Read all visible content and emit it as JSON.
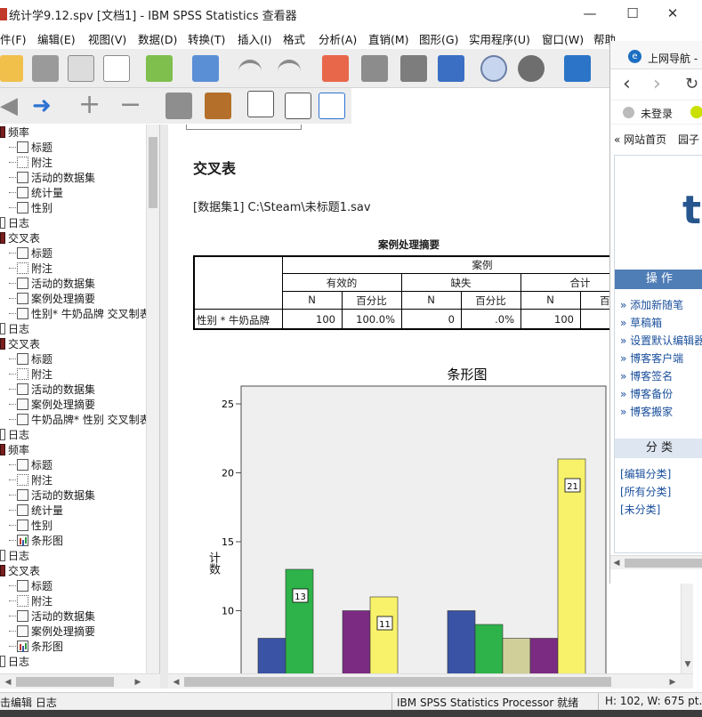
{
  "window": {
    "title": "统计学9.12.spv [文档1] - IBM SPSS Statistics 查看器",
    "minimize": "—",
    "maximize": "☐",
    "close": "✕"
  },
  "menu": [
    "件(F)",
    "编辑(E)",
    "视图(V)",
    "数据(D)",
    "转换(T)",
    "插入(I)",
    "格式",
    "分析(A)",
    "直销(M)",
    "图形(G)",
    "实用程序(U)",
    "窗口(W)",
    "帮助"
  ],
  "toolbar1": [
    "open-folder-icon",
    "save-icon",
    "print-icon",
    "print-preview-icon",
    "export-icon",
    "recall-dialog-icon",
    "undo-icon",
    "redo-icon",
    "goto-data-icon",
    "goto-case-icon",
    "goto-variable-icon",
    "variables-icon",
    "use-sets-icon",
    "show-all-icon",
    "spelling-icon"
  ],
  "toolbar2": [
    "back-arrow-icon",
    "forward-arrow-icon",
    "expand-plus-icon",
    "collapse-minus-icon",
    "show-icon",
    "hide-icon",
    "insert-heading-icon",
    "insert-title-icon",
    "insert-text-icon"
  ],
  "outline": [
    {
      "level": 0,
      "label": "频率",
      "icon": "book"
    },
    {
      "level": 1,
      "label": "标题",
      "icon": "doc"
    },
    {
      "level": 1,
      "label": "附注",
      "icon": "hidden"
    },
    {
      "level": 1,
      "label": "活动的数据集",
      "icon": "doc"
    },
    {
      "level": 1,
      "label": "统计量",
      "icon": "table"
    },
    {
      "level": 1,
      "label": "性别",
      "icon": "table"
    },
    {
      "level": 0,
      "label": "日志",
      "icon": "doc"
    },
    {
      "level": 0,
      "label": "交叉表",
      "icon": "book"
    },
    {
      "level": 1,
      "label": "标题",
      "icon": "doc"
    },
    {
      "level": 1,
      "label": "附注",
      "icon": "hidden"
    },
    {
      "level": 1,
      "label": "活动的数据集",
      "icon": "doc"
    },
    {
      "level": 1,
      "label": "案例处理摘要",
      "icon": "table"
    },
    {
      "level": 1,
      "label": "性别* 牛奶品牌 交叉制表",
      "icon": "table"
    },
    {
      "level": 0,
      "label": "日志",
      "icon": "doc"
    },
    {
      "level": 0,
      "label": "交叉表",
      "icon": "book"
    },
    {
      "level": 1,
      "label": "标题",
      "icon": "doc"
    },
    {
      "level": 1,
      "label": "附注",
      "icon": "hidden"
    },
    {
      "level": 1,
      "label": "活动的数据集",
      "icon": "doc"
    },
    {
      "level": 1,
      "label": "案例处理摘要",
      "icon": "table"
    },
    {
      "level": 1,
      "label": "牛奶品牌* 性别 交叉制表",
      "icon": "table"
    },
    {
      "level": 0,
      "label": "日志",
      "icon": "doc"
    },
    {
      "level": 0,
      "label": "频率",
      "icon": "book"
    },
    {
      "level": 1,
      "label": "标题",
      "icon": "doc"
    },
    {
      "level": 1,
      "label": "附注",
      "icon": "hidden"
    },
    {
      "level": 1,
      "label": "活动的数据集",
      "icon": "doc"
    },
    {
      "level": 1,
      "label": "统计量",
      "icon": "table"
    },
    {
      "level": 1,
      "label": "性别",
      "icon": "table"
    },
    {
      "level": 1,
      "label": "条形图",
      "icon": "chart"
    },
    {
      "level": 0,
      "label": "日志",
      "icon": "doc"
    },
    {
      "level": 0,
      "label": "交叉表",
      "icon": "book"
    },
    {
      "level": 1,
      "label": "标题",
      "icon": "doc"
    },
    {
      "level": 1,
      "label": "附注",
      "icon": "hidden"
    },
    {
      "level": 1,
      "label": "活动的数据集",
      "icon": "doc"
    },
    {
      "level": 1,
      "label": "案例处理摘要",
      "icon": "table"
    },
    {
      "level": 1,
      "label": "条形图",
      "icon": "chart"
    },
    {
      "level": 0,
      "label": "日志",
      "icon": "doc"
    }
  ],
  "content": {
    "heading": "交叉表",
    "dataset": "[数据集1] C:\\Steam\\未标题1.sav",
    "summary_table": {
      "title": "案例处理摘要",
      "group_header": "案例",
      "col_groups": [
        "有效的",
        "缺失",
        "合计"
      ],
      "sub_headers": [
        "N",
        "百分比",
        "N",
        "百分比",
        "N",
        "百分"
      ],
      "row_label": "性别 * 牛奶品牌",
      "row_values": [
        "100",
        "100.0%",
        "0",
        ".0%",
        "100",
        "100"
      ]
    }
  },
  "chart_data": {
    "type": "bar",
    "title": "条形图",
    "ylabel": "计数",
    "ylim": [
      0,
      25
    ],
    "yticks": [
      10,
      15,
      20,
      25
    ],
    "colors": [
      "#3a53a4",
      "#2eb34a",
      "#d1cf99",
      "#7b2c82",
      "#f7f26a"
    ],
    "groups": [
      {
        "values": [
          8,
          13,
          null,
          null,
          null
        ],
        "labels": [
          "",
          "13",
          "",
          "",
          ""
        ]
      },
      {
        "values": [
          null,
          null,
          null,
          10,
          11
        ],
        "labels": [
          "",
          "",
          "",
          "",
          "11"
        ]
      },
      {
        "values": [
          10,
          9,
          8,
          8,
          21
        ],
        "labels": [
          "",
          "",
          "",
          "",
          "21"
        ]
      }
    ]
  },
  "browser": {
    "tab_title": "上网导航 -",
    "login": "未登录",
    "nav_links": [
      "« 网站首页",
      "园子"
    ],
    "section_ops": "操  作",
    "ops_links": [
      "添加新随笔",
      "草稿箱",
      "设置默认编辑器",
      "博客客户端",
      "博客签名",
      "博客备份",
      "博客搬家"
    ],
    "section_cat": "分  类",
    "cat_links": [
      "[编辑分类]",
      "[所有分类]",
      "[未分类]"
    ]
  },
  "status": {
    "left": "击编辑 日志",
    "processor": "IBM SPSS Statistics Processor 就绪",
    "dimensions": "H: 102, W: 675 pt."
  }
}
